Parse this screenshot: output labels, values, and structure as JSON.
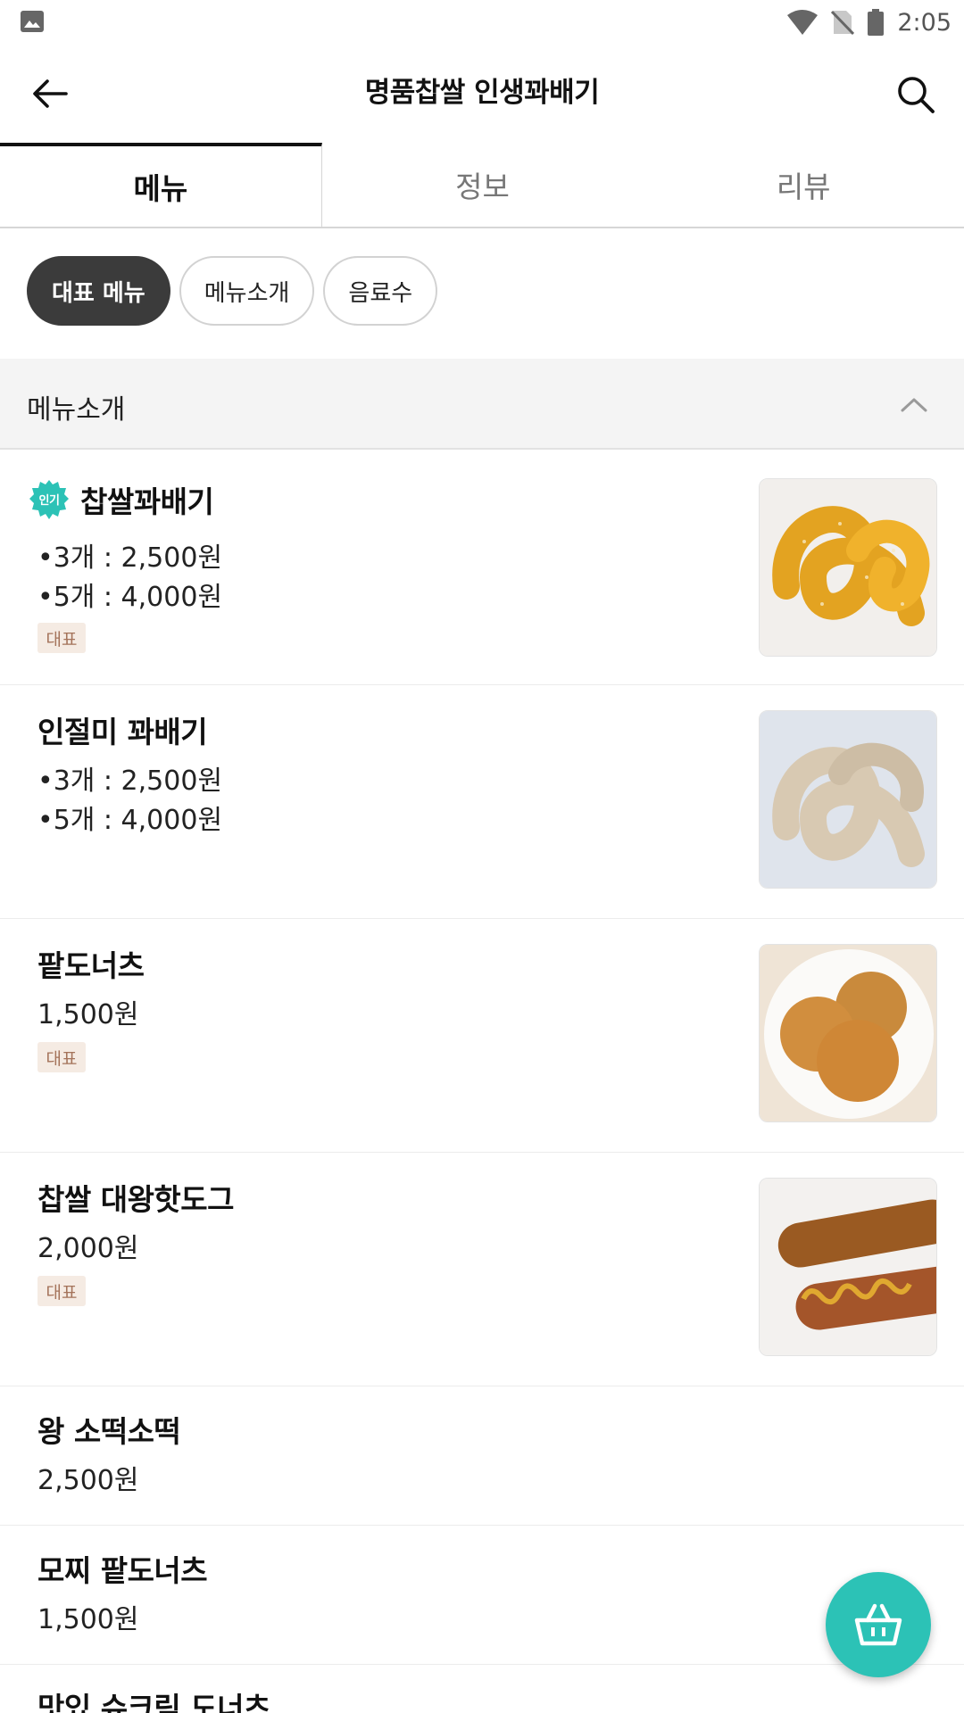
{
  "status_bar": {
    "time": "2:05",
    "icons": [
      "image-icon",
      "wifi-icon",
      "no-sim-icon",
      "battery-icon"
    ]
  },
  "app_bar": {
    "title": "명품찹쌀 인생꽈배기",
    "back_icon": "arrow-left-icon",
    "search_icon": "search-icon"
  },
  "tabs": [
    {
      "label": "메뉴",
      "active": true
    },
    {
      "label": "정보",
      "active": false
    },
    {
      "label": "리뷰",
      "active": false
    }
  ],
  "chips": [
    {
      "label": "대표 메뉴",
      "active": true
    },
    {
      "label": "메뉴소개",
      "active": false
    },
    {
      "label": "음료수",
      "active": false
    }
  ],
  "section": {
    "title": "메뉴소개",
    "toggle_icon": "chevron-up-icon"
  },
  "menu_items": [
    {
      "popular_label": "인기",
      "name": "찹쌀꽈배기",
      "lines": [
        "•3개 : 2,500원",
        "•5개 : 4,000원"
      ],
      "badge": "대표",
      "image": "twisted-doughnut-sugar"
    },
    {
      "name": "인절미 꽈배기",
      "lines": [
        "•3개 : 2,500원",
        "•5개 : 4,000원"
      ],
      "image": "twisted-doughnut-injeolmi"
    },
    {
      "name": "팥도너츠",
      "lines": [
        "1,500원"
      ],
      "badge": "대표",
      "image": "red-bean-doughnut"
    },
    {
      "name": "찹쌀 대왕핫도그",
      "lines": [
        "2,000원"
      ],
      "badge": "대표",
      "image": "corn-dog"
    },
    {
      "name": "왕 소떡소떡",
      "lines": [
        "2,500원"
      ]
    },
    {
      "name": "모찌 팥도너츠",
      "lines": [
        "1,500원"
      ]
    },
    {
      "name": "맛있 슈크림 도너츠",
      "lines": []
    }
  ],
  "fab": {
    "icon": "basket-icon"
  },
  "colors": {
    "accent": "#2cc2b6",
    "chip_active": "#3b3b3b",
    "badge_bg": "#f5ebe3",
    "badge_text": "#a4735a"
  }
}
